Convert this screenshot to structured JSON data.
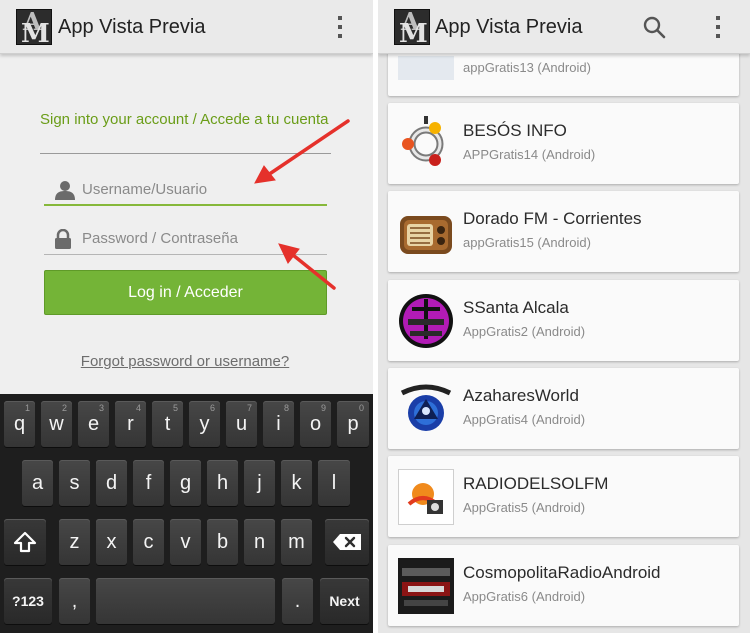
{
  "left_screen": {
    "app_title": "App Vista Previa",
    "logo_letters": [
      "A",
      "M"
    ],
    "signin_heading": "Sign into your account / Accede a tu cuenta",
    "username_placeholder": "Username/Usuario",
    "password_placeholder": "Password / Contraseña",
    "login_label": "Log in / Acceder",
    "forgot_link": "Forgot password or username?",
    "keyboard": {
      "row1": [
        {
          "key": "q",
          "hint": "1"
        },
        {
          "key": "w",
          "hint": "2"
        },
        {
          "key": "e",
          "hint": "3"
        },
        {
          "key": "r",
          "hint": "4"
        },
        {
          "key": "t",
          "hint": "5"
        },
        {
          "key": "y",
          "hint": "6"
        },
        {
          "key": "u",
          "hint": "7"
        },
        {
          "key": "i",
          "hint": "8"
        },
        {
          "key": "o",
          "hint": "9"
        },
        {
          "key": "p",
          "hint": "0"
        }
      ],
      "row2": [
        "a",
        "s",
        "d",
        "f",
        "g",
        "h",
        "j",
        "k",
        "l"
      ],
      "row3": [
        "z",
        "x",
        "c",
        "v",
        "b",
        "n",
        "m"
      ],
      "symbols_label": "?123",
      "comma": ",",
      "period": ".",
      "next_label": "Next"
    },
    "arrow_color": "#e5312b",
    "accent_color": "#74b437"
  },
  "right_screen": {
    "app_title": "App Vista Previa",
    "partial_item_sub": "appGratis13 (Android)",
    "apps": [
      {
        "name": "BESÓS INFO",
        "sub": "APPGratis14 (Android)",
        "icon": "ubuntu-logo-icon"
      },
      {
        "name": "Dorado FM - Corrientes",
        "sub": "appGratis15 (Android)",
        "icon": "radio-icon"
      },
      {
        "name": "SSanta Alcala",
        "sub": "AppGratis2 (Android)",
        "icon": "cross-emblem-icon"
      },
      {
        "name": "AzaharesWorld",
        "sub": "AppGratis4 (Android)",
        "icon": "azahares-logo-icon"
      },
      {
        "name": "RADIODELSOLFM",
        "sub": "AppGratis5 (Android)",
        "icon": "radiodelsol-logo-icon"
      },
      {
        "name": "CosmopolitaRadioAndroid",
        "sub": "AppGratis6 (Android)",
        "icon": "cosmopolita-logo-icon"
      }
    ]
  }
}
